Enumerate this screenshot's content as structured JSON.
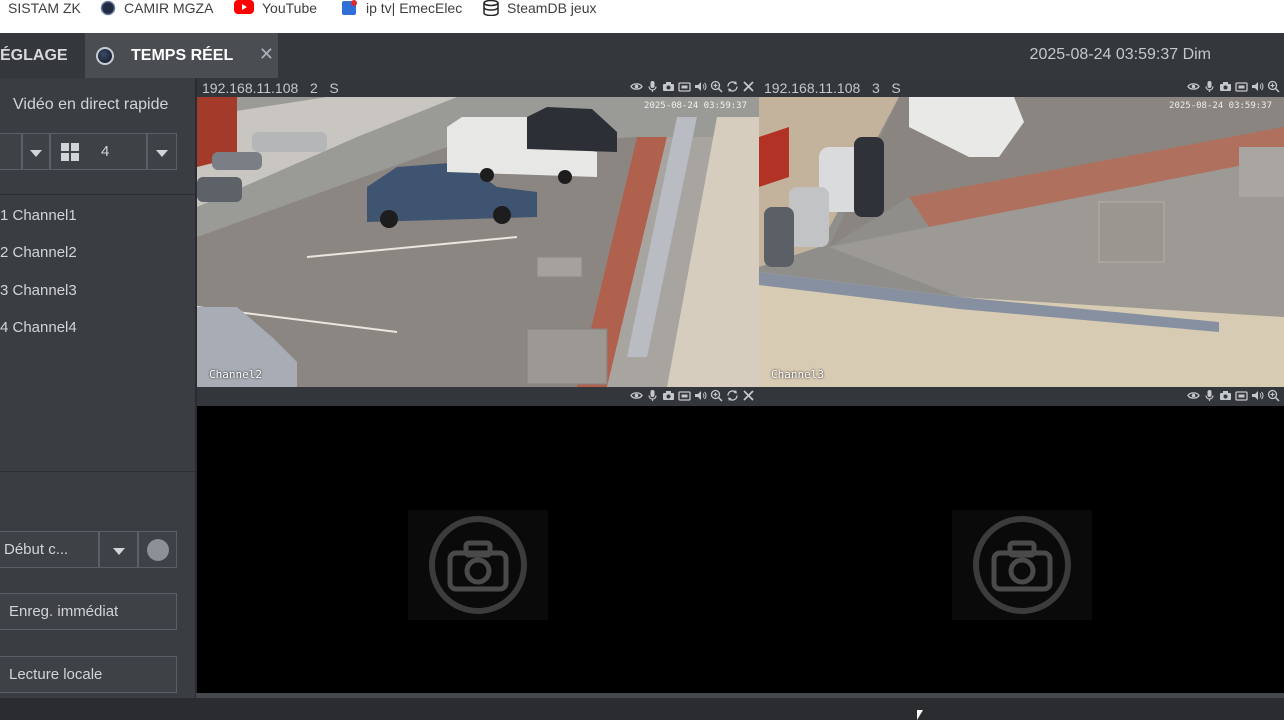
{
  "bookmarks": [
    {
      "label": "SISTAM ZK",
      "icon": "generic-bookmark-icon"
    },
    {
      "label": "CAMIR MGZA",
      "icon": "globe-icon"
    },
    {
      "label": "YouTube",
      "icon": "youtube-icon"
    },
    {
      "label": "ip tv| EmecElec",
      "icon": "iptv-icon"
    },
    {
      "label": "SteamDB jeux",
      "icon": "steamdb-icon"
    }
  ],
  "header": {
    "tab_reglage": "ÉGLAGE",
    "tab_live": "TEMPS RÉEL",
    "tab_close": "✕",
    "datetime": "2025-08-24 03:59:37 Dim"
  },
  "sidebar": {
    "title": "Vidéo en direct rapide",
    "split_value": "4",
    "channels": [
      "1 Channel1",
      "2 Channel2",
      "3 Channel3",
      "4 Channel4"
    ],
    "record_select": "Début c...",
    "btn_record_now": "Enreg. immédiat",
    "btn_local_playback": "Lecture locale"
  },
  "panels": [
    {
      "ip": "192.168.11.108",
      "channel_no": "2",
      "stream": "S",
      "osd_channel": "Channel2",
      "osd_time": "2025-08-24 03:59:37",
      "state": "live"
    },
    {
      "ip": "192.168.11.108",
      "channel_no": "3",
      "stream": "S",
      "osd_channel": "Channel3",
      "osd_time": "2025-08-24 03:59:37",
      "state": "live"
    },
    {
      "ip": "",
      "channel_no": "",
      "stream": "",
      "state": "no-video"
    },
    {
      "ip": "",
      "channel_no": "",
      "stream": "",
      "state": "no-video"
    }
  ],
  "panel_icons": [
    "eye-icon",
    "microphone-icon",
    "snapshot-icon",
    "record-icon",
    "speaker-icon",
    "zoom-icon",
    "refresh-icon",
    "close-icon"
  ],
  "colors": {
    "accent": "#4a4d52",
    "header": "#34373b",
    "sidebar": "#3a3d41"
  }
}
